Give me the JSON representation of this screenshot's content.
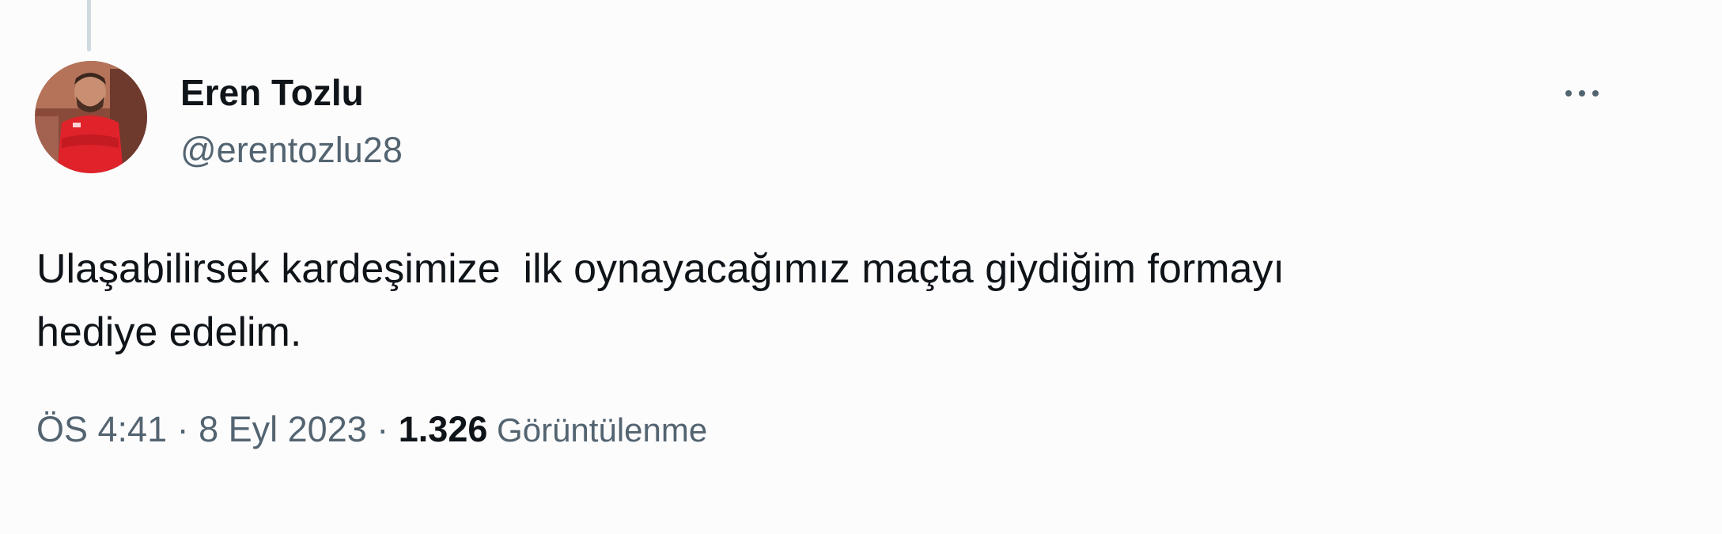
{
  "author": {
    "name": "Eren Tozlu",
    "handle": "@erentozlu28",
    "avatar": "profile-photo"
  },
  "menu": {
    "icon": "more-horizontal-icon"
  },
  "tweet": {
    "text": "Ulaşabilirsek kardeşimize  ilk oynayacağımız maçta giydiğim formayı\nhediye edelim."
  },
  "meta": {
    "time": "ÖS 4:41",
    "separator": " · ",
    "date": "8 Eyl 2023",
    "separator2": " · ",
    "views_count": "1.326",
    "views_label": " Görüntülenme"
  },
  "colors": {
    "primary_text": "#0f1419",
    "secondary_text": "#536471",
    "background": "#fdfcfd",
    "thread_line": "#cfd9de"
  }
}
